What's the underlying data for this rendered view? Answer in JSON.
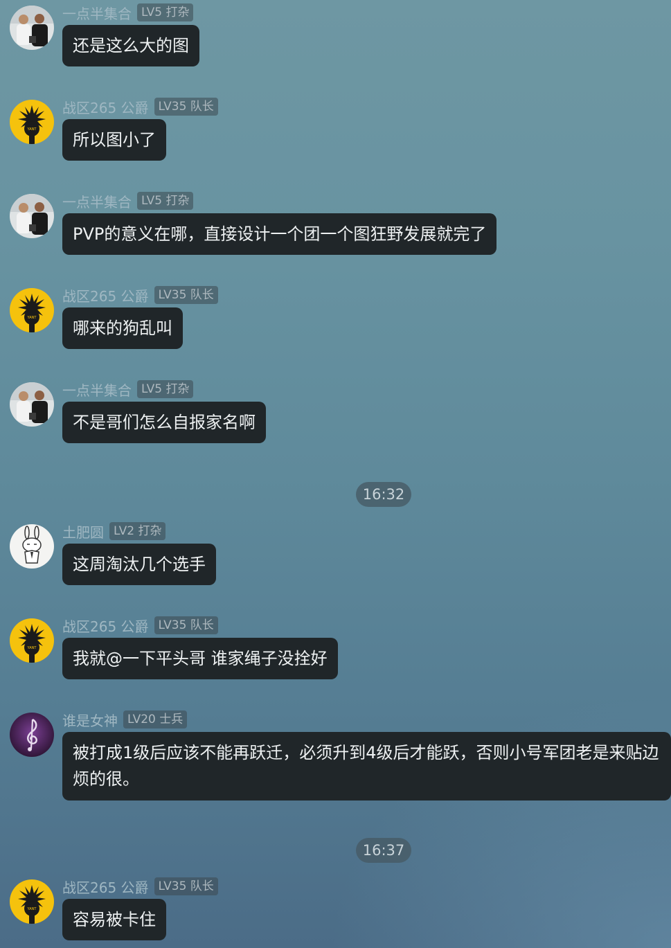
{
  "colors": {
    "bubble_bg": "#202629",
    "bubble_text": "#eef1f2",
    "name_text": "#9fb7c2",
    "badge_text": "#aeb9bf",
    "yellow_avatar": "#f5c20d"
  },
  "messages": [
    {
      "avatar": "photo-avatar-icon",
      "name": "一点半集合",
      "badge": "LV5 打杂",
      "text": "还是这么大的图"
    },
    {
      "avatar": "yellow-tree-avatar-icon",
      "name": "战区265 公爵",
      "badge": "LV35 队长",
      "text": "所以图小了"
    },
    {
      "avatar": "photo-avatar-icon",
      "name": "一点半集合",
      "badge": "LV5 打杂",
      "text": "PVP的意义在哪，直接设计一个团一个图狂野发展就完了"
    },
    {
      "avatar": "yellow-tree-avatar-icon",
      "name": "战区265 公爵",
      "badge": "LV35 队长",
      "text": "哪来的狗乱叫"
    },
    {
      "avatar": "photo-avatar-icon",
      "name": "一点半集合",
      "badge": "LV5 打杂",
      "text": "不是哥们怎么自报家名啊"
    },
    {
      "avatar": "rabbit-avatar-icon",
      "name": "土肥圆",
      "badge": "LV2 打杂",
      "text": "这周淘汰几个选手"
    },
    {
      "avatar": "yellow-tree-avatar-icon",
      "name": "战区265 公爵",
      "badge": "LV35 队长",
      "text": "我就@一下平头哥 谁家绳子没拴好"
    },
    {
      "avatar": "music-note-avatar-icon",
      "name": "谁是女神",
      "badge": "LV20 士兵",
      "text": "被打成1级后应该不能再跃迁，必须升到4级后才能跃，否则小号军团老是来贴边烦的很。"
    },
    {
      "avatar": "yellow-tree-avatar-icon",
      "name": "战区265 公爵",
      "badge": "LV35 队长",
      "text": "容易被卡住"
    }
  ],
  "timestamps": [
    "16:32",
    "16:37"
  ]
}
